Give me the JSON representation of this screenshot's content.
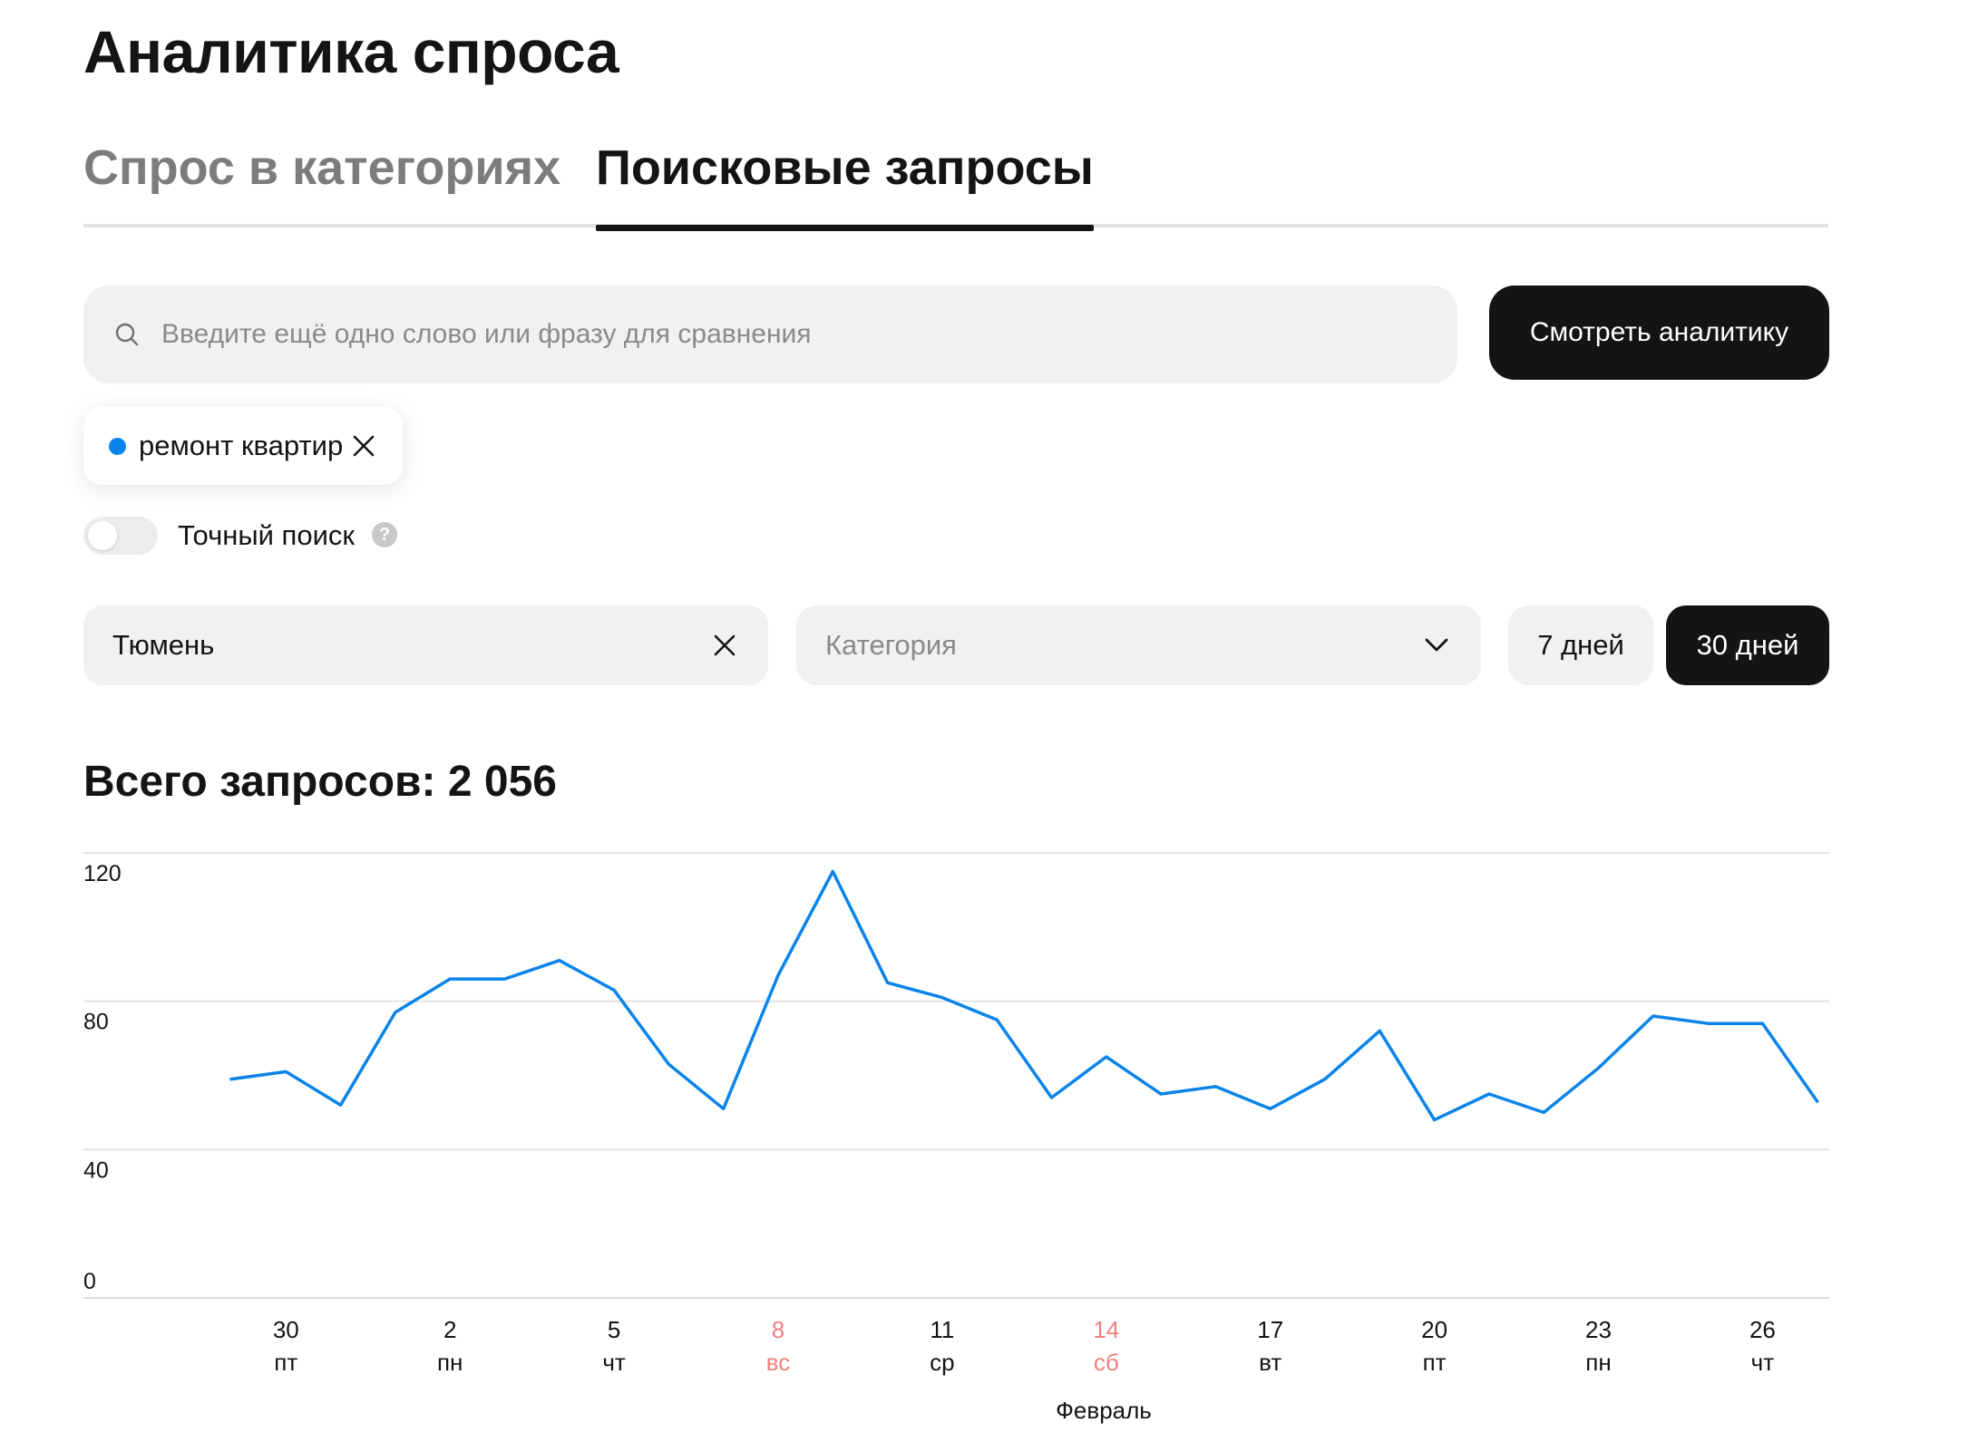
{
  "page": {
    "title": "Аналитика спроса"
  },
  "tabs": [
    {
      "label": "Спрос в категориях",
      "active": false
    },
    {
      "label": "Поисковые запросы",
      "active": true
    }
  ],
  "search": {
    "placeholder": "Введите ещё одно слово или фразу для сравнения",
    "value": "",
    "button_label": "Смотреть аналитику"
  },
  "chips": [
    {
      "label": "ремонт квартир",
      "color": "#0a84ea"
    }
  ],
  "exact_search": {
    "label": "Точный поиск",
    "enabled": false,
    "help_icon": "question-circle-icon"
  },
  "filters": {
    "city": {
      "value": "Тюмень"
    },
    "category": {
      "placeholder": "Категория"
    },
    "periods": [
      {
        "label": "7 дней",
        "selected": false
      },
      {
        "label": "30 дней",
        "selected": true
      }
    ]
  },
  "total": {
    "label": "Всего запросов: 2 056"
  },
  "colors": {
    "accent": "#141414",
    "line": "#0a84ea",
    "weekend": "#f08080"
  },
  "chart_data": {
    "type": "line",
    "ylim": [
      0,
      120
    ],
    "yticks": [
      0,
      40,
      80,
      120
    ],
    "x_start_day": 29,
    "series": [
      {
        "name": "ремонт квартир",
        "values": [
          59,
          61,
          52,
          77,
          86,
          86,
          91,
          83,
          63,
          51,
          87,
          115,
          85,
          81,
          75,
          54,
          65,
          55,
          57,
          51,
          59,
          72,
          48,
          55,
          50,
          62,
          76,
          74,
          74,
          53
        ]
      }
    ],
    "xticks": [
      {
        "index": 1,
        "day": "30",
        "weekday": "пт",
        "weekend": false
      },
      {
        "index": 4,
        "day": "2",
        "weekday": "пн",
        "weekend": false
      },
      {
        "index": 7,
        "day": "5",
        "weekday": "чт",
        "weekend": false
      },
      {
        "index": 10,
        "day": "8",
        "weekday": "вс",
        "weekend": true
      },
      {
        "index": 13,
        "day": "11",
        "weekday": "ср",
        "weekend": false
      },
      {
        "index": 16,
        "day": "14",
        "weekday": "сб",
        "weekend": true
      },
      {
        "index": 19,
        "day": "17",
        "weekday": "вт",
        "weekend": false
      },
      {
        "index": 22,
        "day": "20",
        "weekday": "пт",
        "weekend": false
      },
      {
        "index": 25,
        "day": "23",
        "weekday": "пн",
        "weekend": false
      },
      {
        "index": 28,
        "day": "26",
        "weekday": "чт",
        "weekend": false
      }
    ],
    "xlabel": "Февраль",
    "grid": true
  }
}
